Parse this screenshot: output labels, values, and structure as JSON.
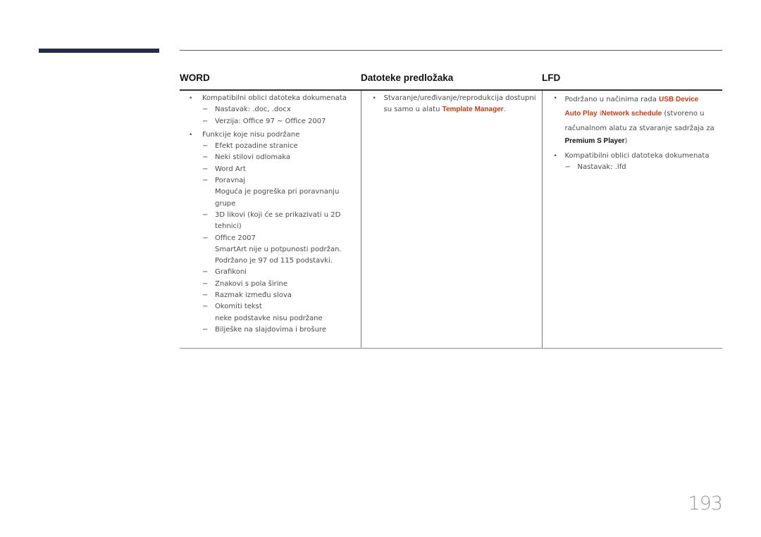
{
  "page_number": "193",
  "table": {
    "headers": {
      "word": "WORD",
      "template": "Datoteke predložaka",
      "lfd": "LFD"
    },
    "word": {
      "items": [
        {
          "bullet": "•",
          "text": "Kompatibilni oblici datoteka dokumenata",
          "subitems": [
            {
              "dash": "−",
              "text": "Nastavak: .doc, .docx",
              "note": ""
            },
            {
              "dash": "−",
              "text": "Verzija: Office 97 ~ Office 2007",
              "note": ""
            }
          ]
        },
        {
          "bullet": "•",
          "text": "Funkcije koje nisu podržane",
          "subitems": [
            {
              "dash": "−",
              "text": "Efekt pozadine stranice",
              "note": ""
            },
            {
              "dash": "−",
              "text": "Neki stilovi odlomaka",
              "note": ""
            },
            {
              "dash": "−",
              "text": "Word Art",
              "note": ""
            },
            {
              "dash": "−",
              "text": "Poravnaj",
              "note": "Moguća je pogreška pri poravnanju grupe"
            },
            {
              "dash": "−",
              "text": "3D likovi (koji će se prikazivati u 2D tehnici)",
              "note": ""
            },
            {
              "dash": "−",
              "text": "Office 2007",
              "note": "SmartArt nije u potpunosti podržan.",
              "note2": "Podržano je 97 od 115 podstavki."
            },
            {
              "dash": "−",
              "text": "Grafikoni",
              "note": ""
            },
            {
              "dash": "−",
              "text": "Znakovi s pola širine",
              "note": ""
            },
            {
              "dash": "−",
              "text": "Razmak između slova",
              "note": ""
            },
            {
              "dash": "−",
              "text": "Okomiti tekst",
              "note": "neke podstavke nisu podržane"
            },
            {
              "dash": "−",
              "text": "Bilješke na slajdovima i brošure",
              "note": ""
            }
          ]
        }
      ]
    },
    "template": {
      "items": [
        {
          "bullet": "•",
          "text_before": "Stvaranje/uređivanje/reprodukcija dostupni su samo u alatu ",
          "highlight": "Template Manager",
          "text_after": "."
        }
      ]
    },
    "lfd": {
      "items": [
        {
          "bullet": "•",
          "text_before": "Podržano u načinima rada ",
          "highlight1": "USB Device",
          "highlight2": "Auto Play",
          "connector": " i",
          "highlight3": "Network schedule",
          "text_mid": " (stvoreno u",
          "text_line3": "računalnom alatu za stvaranje sadržaja za",
          "bold": "Premium S Player",
          "text_after": ")"
        },
        {
          "bullet": "•",
          "text": "Kompatibilni oblici datoteka dokumenata",
          "subitems": [
            {
              "dash": "−",
              "text": "Nastavak: .lfd"
            }
          ]
        }
      ]
    }
  },
  "colors": {
    "accent_red": "#c13d15",
    "side_bar": "#272b4a"
  }
}
